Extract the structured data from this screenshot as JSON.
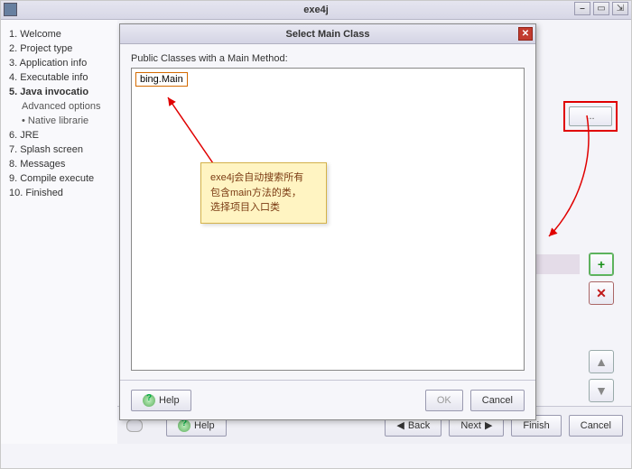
{
  "window": {
    "title": "exe4j"
  },
  "steps": [
    {
      "num": "1.",
      "label": "Welcome"
    },
    {
      "num": "2.",
      "label": "Project type"
    },
    {
      "num": "3.",
      "label": "Application info"
    },
    {
      "num": "4.",
      "label": "Executable info"
    },
    {
      "num": "5.",
      "label": "Java invocatio",
      "bold": true
    },
    {
      "label": "Advanced options",
      "sub": true
    },
    {
      "label": "Native librarie",
      "sub": true,
      "dot": true
    },
    {
      "num": "6.",
      "label": "JRE"
    },
    {
      "num": "7.",
      "label": "Splash screen"
    },
    {
      "num": "8.",
      "label": "Messages"
    },
    {
      "num": "9.",
      "label": "Compile execute"
    },
    {
      "num": "10.",
      "label": "Finished"
    }
  ],
  "modal": {
    "title": "Select Main Class",
    "list_label": "Public Classes with a Main Method:",
    "selected": "bing.Main",
    "help": "Help",
    "ok": "OK",
    "cancel": "Cancel"
  },
  "note": {
    "line1": "exe4j会自动搜索所有",
    "line2": "包含main方法的类，",
    "line3": "选择项目入口类"
  },
  "wizard": {
    "help": "Help",
    "back": "Back",
    "next": "Next",
    "finish": "Finish",
    "cancel": "Cancel"
  },
  "browse": "..."
}
